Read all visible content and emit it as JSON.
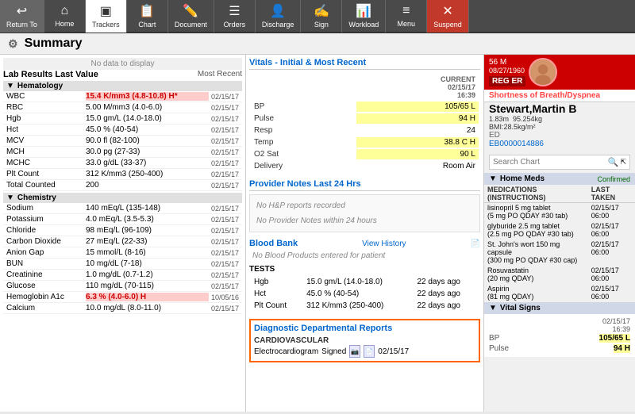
{
  "toolbar": {
    "buttons": [
      {
        "label": "Return To",
        "icon": "↩",
        "active": false
      },
      {
        "label": "Home",
        "icon": "⌂",
        "active": false
      },
      {
        "label": "Trackers",
        "icon": "◫",
        "active": true
      },
      {
        "label": "Chart",
        "icon": "📋",
        "active": false
      },
      {
        "label": "Document",
        "icon": "✏️",
        "active": false
      },
      {
        "label": "Orders",
        "icon": "☰",
        "active": false
      },
      {
        "label": "Discharge",
        "icon": "👤",
        "active": false
      },
      {
        "label": "Sign",
        "icon": "✍",
        "active": false
      },
      {
        "label": "Workload",
        "icon": "📊",
        "active": false
      },
      {
        "label": "Menu",
        "icon": "≡",
        "active": false
      },
      {
        "label": "Suspend",
        "icon": "✕",
        "active": false
      }
    ]
  },
  "page_title": "Summary",
  "no_data_label": "No data to display",
  "lab_results": {
    "title": "Lab Results Last Value",
    "most_recent_label": "Most Recent",
    "groups": [
      {
        "name": "Hematology",
        "rows": [
          {
            "name": "WBC",
            "value": "15.4 K/mm3 (4.8-10.8) H*",
            "date": "02/15/17",
            "highlight": "red"
          },
          {
            "name": "RBC",
            "value": "5.00 M/mm3 (4.0-6.0)",
            "date": "02/15/17",
            "highlight": "none"
          },
          {
            "name": "Hgb",
            "value": "15.0 gm/L (14.0-18.0)",
            "date": "02/15/17",
            "highlight": "none"
          },
          {
            "name": "Hct",
            "value": "45.0 % (40-54)",
            "date": "02/15/17",
            "highlight": "none"
          },
          {
            "name": "MCV",
            "value": "90.0 fl (82-100)",
            "date": "02/15/17",
            "highlight": "none"
          },
          {
            "name": "MCH",
            "value": "30.0 pg (27-33)",
            "date": "02/15/17",
            "highlight": "none"
          },
          {
            "name": "MCHC",
            "value": "33.0 g/dL (33-37)",
            "date": "02/15/17",
            "highlight": "none"
          },
          {
            "name": "Plt Count",
            "value": "312 K/mm3 (250-400)",
            "date": "02/15/17",
            "highlight": "none"
          },
          {
            "name": "Total Counted",
            "value": "200",
            "date": "02/15/17",
            "highlight": "none"
          }
        ]
      },
      {
        "name": "Chemistry",
        "rows": [
          {
            "name": "Sodium",
            "value": "140 mEq/L (135-148)",
            "date": "02/15/17",
            "highlight": "none"
          },
          {
            "name": "Potassium",
            "value": "4.0 mEq/L (3.5-5.3)",
            "date": "02/15/17",
            "highlight": "none"
          },
          {
            "name": "Chloride",
            "value": "98 mEq/L (96-109)",
            "date": "02/15/17",
            "highlight": "none"
          },
          {
            "name": "Carbon Dioxide",
            "value": "27 mEq/L (22-33)",
            "date": "02/15/17",
            "highlight": "none"
          },
          {
            "name": "Anion Gap",
            "value": "15 mmol/L (8-16)",
            "date": "02/15/17",
            "highlight": "none"
          },
          {
            "name": "BUN",
            "value": "10 mg/dL (7-18)",
            "date": "02/15/17",
            "highlight": "none"
          },
          {
            "name": "Creatinine",
            "value": "1.0 mg/dL (0.7-1.2)",
            "date": "02/15/17",
            "highlight": "none"
          },
          {
            "name": "Glucose",
            "value": "110 mg/dL (70-115)",
            "date": "02/15/17",
            "highlight": "none"
          },
          {
            "name": "Hemoglobin A1c",
            "value": "6.3 % (4.0-6.0) H",
            "date": "10/05/16",
            "highlight": "red"
          },
          {
            "name": "Calcium",
            "value": "10.0 mg/dL (8.0-11.0)",
            "date": "02/15/17",
            "highlight": "none"
          }
        ]
      }
    ]
  },
  "vitals": {
    "title": "Vitals - Initial & Most Recent",
    "current_label": "CURRENT",
    "current_date": "02/15/17",
    "current_time": "16:39",
    "rows": [
      {
        "name": "BP",
        "value": "105/65 L",
        "highlight": "yellow"
      },
      {
        "name": "Pulse",
        "value": "94 H",
        "highlight": "yellow"
      },
      {
        "name": "Resp",
        "value": "24",
        "highlight": "none"
      },
      {
        "name": "Temp",
        "value": "38.8 C H",
        "highlight": "yellow"
      },
      {
        "name": "O2 Sat",
        "value": "90 L",
        "highlight": "yellow"
      },
      {
        "name": "Delivery",
        "value": "Room Air",
        "highlight": "none"
      }
    ]
  },
  "provider_notes": {
    "title": "Provider Notes Last 24 Hrs",
    "no_hp_msg": "No H&P reports recorded",
    "no_notes_msg": "No Provider Notes within 24 hours"
  },
  "blood_bank": {
    "title": "Blood Bank",
    "view_history_label": "View History",
    "no_products_msg": "No Blood Products entered for patient",
    "tests_label": "TESTS",
    "tests": [
      {
        "name": "Hgb",
        "value": "15.0 gm/L (14.0-18.0)",
        "age": "22 days ago"
      },
      {
        "name": "Hct",
        "value": "45.0 % (40-54)",
        "age": "22 days ago"
      },
      {
        "name": "Plt Count",
        "value": "312 K/mm3 (250-400)",
        "age": "22 days ago"
      }
    ]
  },
  "diagnostic_reports": {
    "title": "Diagnostic Departmental Reports",
    "category": "CARDIOVASCULAR",
    "item": "Electrocardiogram",
    "status": "Signed",
    "date": "02/15/17"
  },
  "patient": {
    "age": "56 M",
    "dob": "08/27/1960",
    "location": "REG ER",
    "diagnosis": "Shortness of Breath/Dyspnea",
    "name": "Stewart,Martin B",
    "height": "1.83m",
    "weight": "95.254kg",
    "bmi": "BMI:28.5kg/m²",
    "department": "ED",
    "id": "EB0000014886",
    "search_placeholder": "Search Chart"
  },
  "home_meds": {
    "title": "Home Meds",
    "status": "Confirmed",
    "col_med": "MEDICATIONS (INSTRUCTIONS)",
    "col_last_taken": "LAST TAKEN",
    "meds": [
      {
        "name": "lisinopril 5 mg tablet (5 mg PO QDAY #30 tab)",
        "last_taken": "02/15/17 06:00"
      },
      {
        "name": "glyburide 2.5 mg tablet (2.5 mg PO QDAY #30 tab)",
        "last_taken": "02/15/17 06:00"
      },
      {
        "name": "St. John's wort 150 mg capsule (300 mg PO QDAY #30 cap)",
        "last_taken": "02/15/17 06:00"
      },
      {
        "name": "Rosuvastatin (20 mg QDAY)",
        "last_taken": "02/15/17 06:00"
      },
      {
        "name": "Aspirin (81 mg QDAY)",
        "last_taken": "02/15/17 06:00"
      }
    ]
  },
  "vital_signs_panel": {
    "title": "Vital Signs",
    "date": "02/15/17",
    "time": "16:39",
    "rows": [
      {
        "label": "BP",
        "value": "105/65 L",
        "highlight": "yellow"
      },
      {
        "label": "Pulse",
        "value": "94 H",
        "highlight": "yellow"
      }
    ]
  },
  "icons": {
    "chevron_down": "▼",
    "chevron_right": "▶",
    "search": "🔍",
    "gear": "⚙",
    "doc_page": "📄",
    "sign": "✍",
    "camera": "📷",
    "print": "🖨"
  }
}
